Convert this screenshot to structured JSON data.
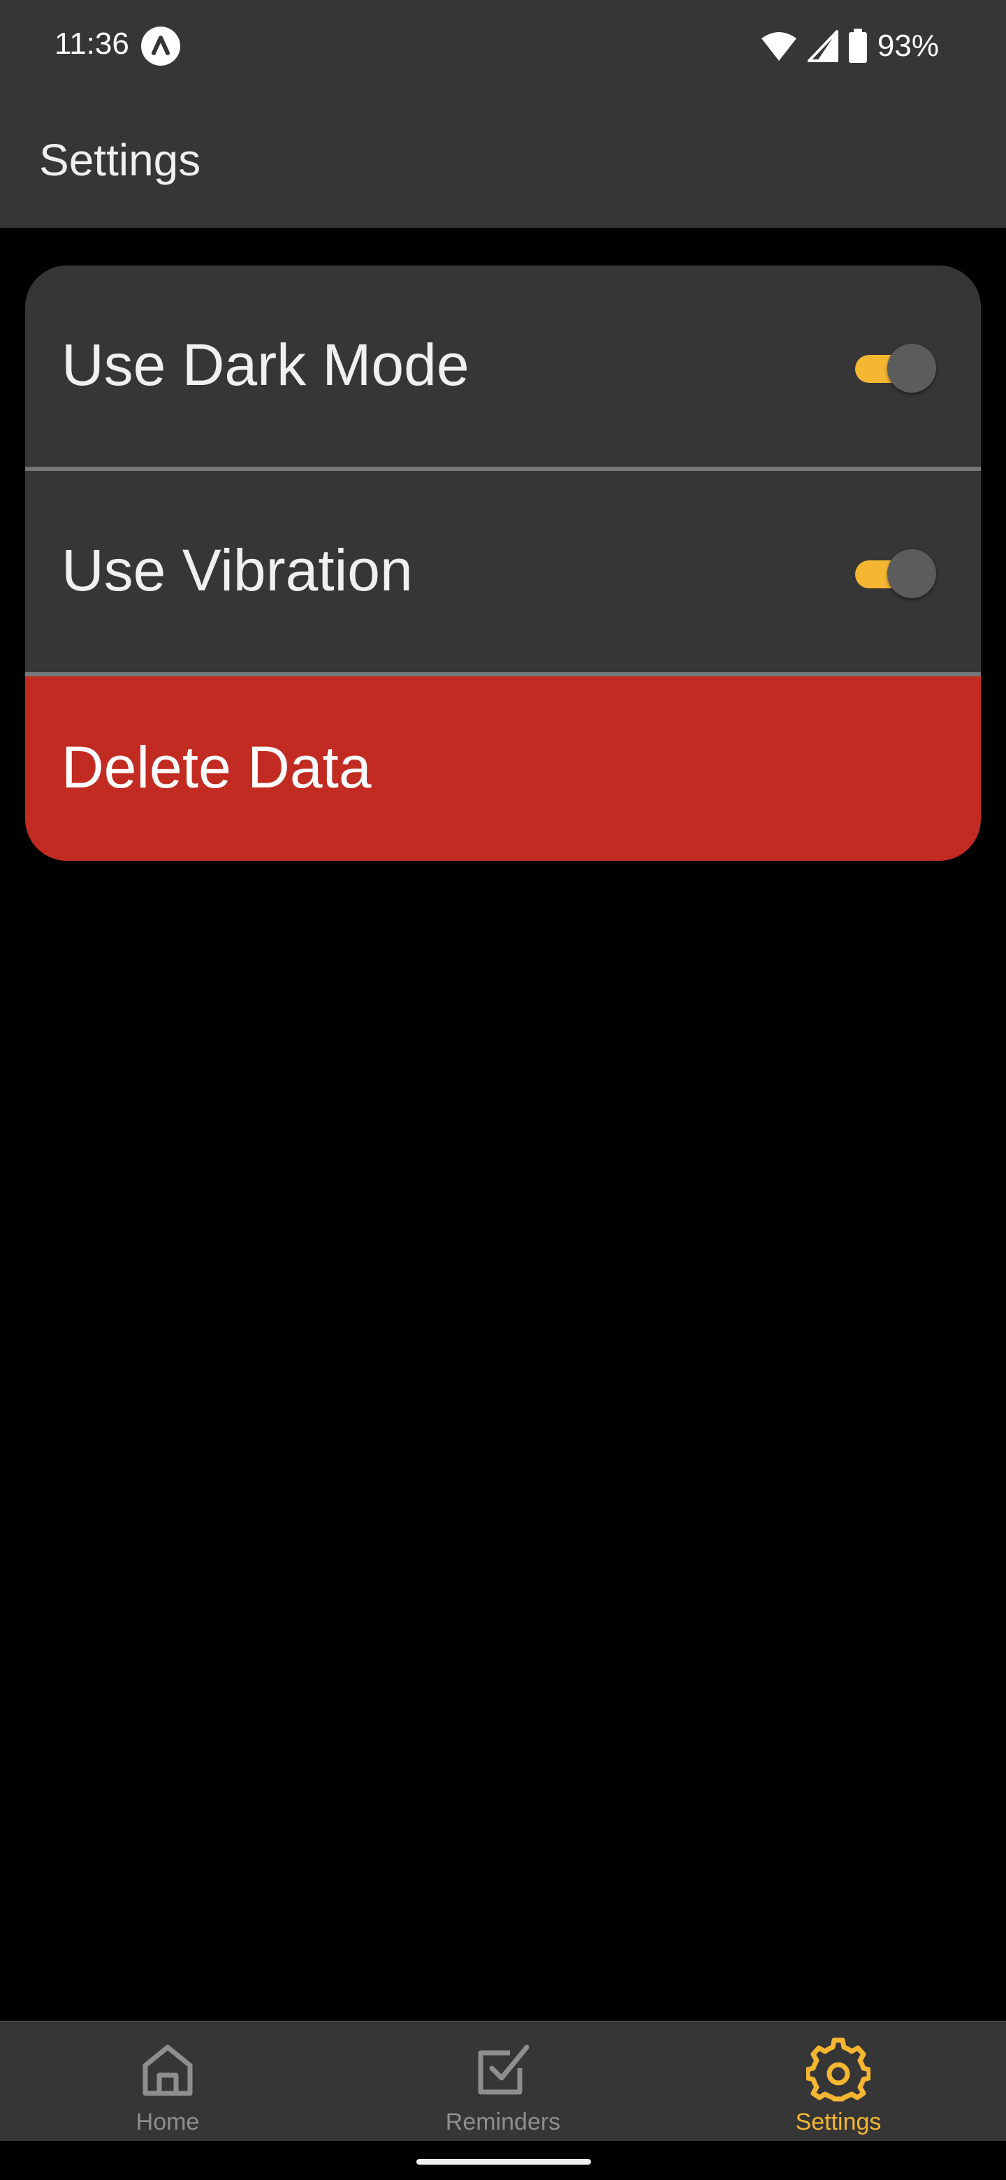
{
  "status_bar": {
    "time": "11:36",
    "battery": "93%",
    "icons": [
      "app-notification-icon",
      "wifi-icon",
      "cellular-signal-icon",
      "battery-icon"
    ]
  },
  "app_bar": {
    "title": "Settings"
  },
  "settings": {
    "items": [
      {
        "label": "Use Dark Mode",
        "enabled": true
      },
      {
        "label": "Use Vibration",
        "enabled": true
      }
    ],
    "delete_label": "Delete Data"
  },
  "bottom_nav": {
    "items": [
      {
        "label": "Home",
        "icon": "home-icon",
        "active": false
      },
      {
        "label": "Reminders",
        "icon": "checkbox-icon",
        "active": false
      },
      {
        "label": "Settings",
        "icon": "gear-icon",
        "active": true
      }
    ]
  },
  "colors": {
    "background": "#000000",
    "surface": "#363636",
    "accent": "#f5b731",
    "danger": "#c22b22",
    "inactive": "#8e8e8e",
    "divider": "#777777"
  }
}
